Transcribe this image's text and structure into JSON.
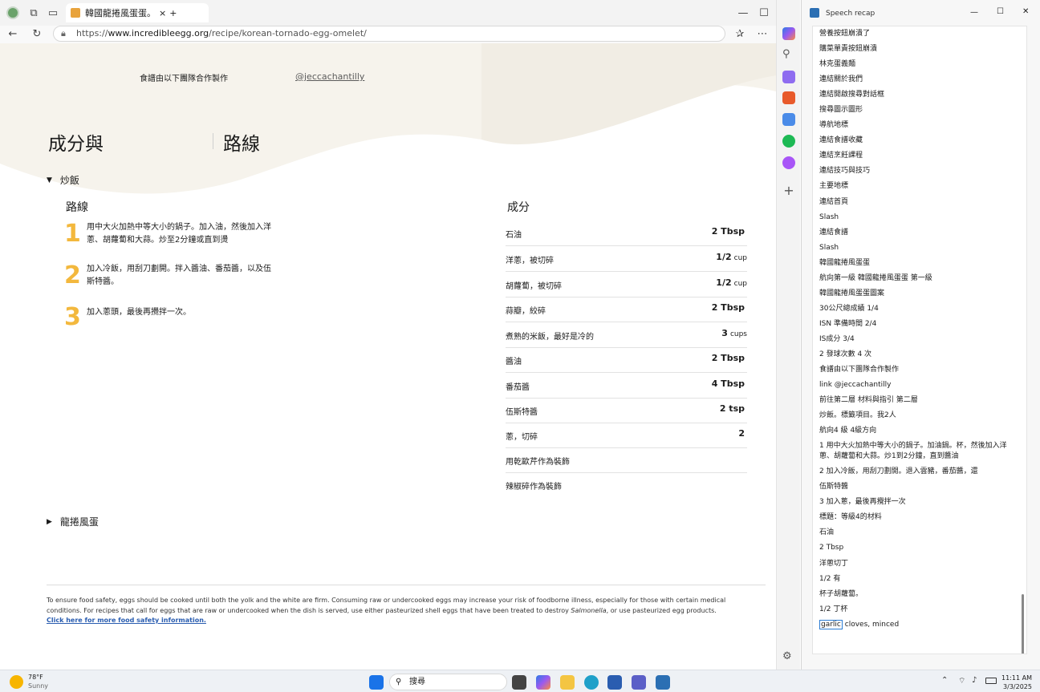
{
  "browser": {
    "tab_title": "韓國龍捲風蛋蛋。",
    "tab_close": "×",
    "tab_new": "+",
    "url_scheme": "https://",
    "url_host": "www.incredibleegg.org",
    "url_path": "/recipe/korean-tornado-egg-omelet/",
    "window_min": "—",
    "window_max": "☐",
    "window_close": "✕"
  },
  "page": {
    "credit_text": "食譜由以下團隊合作製作",
    "credit_link": "@jeccachantilly",
    "heading_left": "成分與",
    "heading_right": "路線",
    "section1": "炒飯",
    "directions_title": "路線",
    "steps": [
      {
        "num": "1",
        "text": "用中大火加熱中等大小的鍋子。加入油，然後加入洋蔥、胡蘿蔔和大蒜。炒至2分鐘或直到燙"
      },
      {
        "num": "2",
        "text": "加入冷飯，用刮刀劃開。拌入醬油、番茄醬，以及伍斯特醬。"
      },
      {
        "num": "3",
        "text": "加入蔥頭，最後再攪拌一次。"
      }
    ],
    "ingredients_title": "成分",
    "ingredients": [
      {
        "name": "石油",
        "qty": "2 Tbsp",
        "unit": ""
      },
      {
        "name": "洋蔥，被切碎",
        "qty": "1/2",
        "unit": "cup"
      },
      {
        "name": "胡蘿蔔，被切碎",
        "qty": "1/2",
        "unit": "cup"
      },
      {
        "name": "蒜瓣，絞碎",
        "qty": "2 Tbsp",
        "unit": ""
      },
      {
        "name": "煮熟的米飯，最好是冷的",
        "qty": "3",
        "unit": "cups"
      },
      {
        "name": "醬油",
        "qty": "2 Tbsp",
        "unit": ""
      },
      {
        "name": "番茄醬",
        "qty": "4 Tbsp",
        "unit": ""
      },
      {
        "name": "伍斯特醬",
        "qty": "2 tsp",
        "unit": ""
      },
      {
        "name": "蔥，切碎",
        "qty": "2",
        "unit": ""
      },
      {
        "name": "用乾歐芹作為裝飾",
        "qty": "",
        "unit": ""
      },
      {
        "name": "辣椒碎作為裝飾",
        "qty": "",
        "unit": ""
      }
    ],
    "section2": "龍捲風蛋",
    "disclaimer_1": "To ensure food safety, eggs should be cooked until both the yolk and the white are firm. Consuming raw or undercooked eggs may increase your risk of foodborne illness, especially for those with certain medical conditions. For recipes that call for eggs that are raw or undercooked when the dish is served, use either pasteurized shell eggs that have been treated to destroy ",
    "disclaimer_italic": "Salmonella",
    "disclaimer_2": ", or use pasteurized egg products.",
    "disclaimer_link": "Click here for more food safety information."
  },
  "recap": {
    "title": "Speech recap",
    "items": [
      "營養按鈕崩潰了",
      "購菜單責按鈕崩潰",
      "林克蛋義麵",
      "連結關於我們",
      "連結開啟搜尋對話框",
      "搜尋圖示圖形",
      "導航地標",
      "連結食譜收藏",
      "連結烹飪課程",
      "連結技巧與技巧",
      "主要地標",
      "連結首頁",
      "Slash",
      "連結食譜",
      "Slash",
      "韓國龍捲風蛋蛋",
      "航向第一級 韓國龍捲風蛋蛋 第一級",
      "韓國龍捲風蛋蛋圖案",
      "30公尺總成績 1/4",
      "ISN 準備時間 2/4",
      "IS成分 3/4",
      "2 發球次數 4 次",
      "食譜由以下團隊合作製作",
      "link @jeccachantilly",
      "前往第二層 材料與指引 第二層",
      "炒飯。標籤項目。我2人",
      "航向4 級 4級方向"
    ],
    "multi_items": [
      "1 用中大火加熱中等大小的鍋子。加油鍋。杯，然後加入洋蔥、胡蘿蔔和大蒜。炒1到2分鐘，直到醬油",
      "2 加入冷飯，用刮刀劃開。退入雲豬，番茄醬，還"
    ],
    "tail_items": [
      "伍斯特醬",
      "3 加入蔥，最後再攪拌一次",
      "標題：等級4的材料",
      "石油",
      "2 Tbsp",
      "洋蔥切丁",
      "1/2 有",
      "杯子胡蘿蔔。",
      "1/2 丁杯"
    ],
    "last_highlight": "garlic",
    "last_rest": " cloves, minced"
  },
  "taskbar": {
    "weather_temp": "78°F",
    "weather_desc": "Sunny",
    "search_placeholder": "搜尋",
    "time": "11:11 AM",
    "date": "3/3/2025"
  },
  "colors": {
    "accent_orange": "#f3b83d",
    "link_gray": "#5b5b5b"
  }
}
